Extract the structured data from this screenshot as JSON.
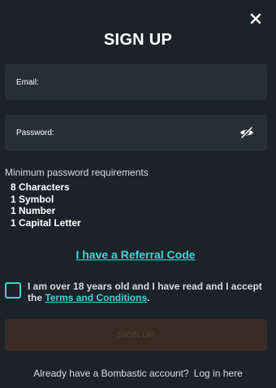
{
  "modal": {
    "title": "SIGN UP",
    "close_icon": "close-icon"
  },
  "form": {
    "email_placeholder": "Email:",
    "password_placeholder": "Password:",
    "password_toggle_icon": "eye-slash-icon"
  },
  "requirements": {
    "title": "Minimum password requirements",
    "items": [
      "8 Characters",
      "1 Symbol",
      "1 Number",
      "1 Capital Letter"
    ]
  },
  "referral": {
    "label": "I have a Referral Code"
  },
  "consent": {
    "text_prefix": "I am over 18 years old and I have read and I accept the ",
    "terms_link": "Terms and Conditions",
    "text_suffix": "."
  },
  "signup_button": {
    "label": "SIGN UP"
  },
  "footer": {
    "question": "Already have a Bombastic account?",
    "login_link": "Log in here"
  },
  "colors": {
    "background": "#1b2329",
    "field_background": "#262f36",
    "accent": "#3fd6d6",
    "button_disabled": "#372b24"
  }
}
